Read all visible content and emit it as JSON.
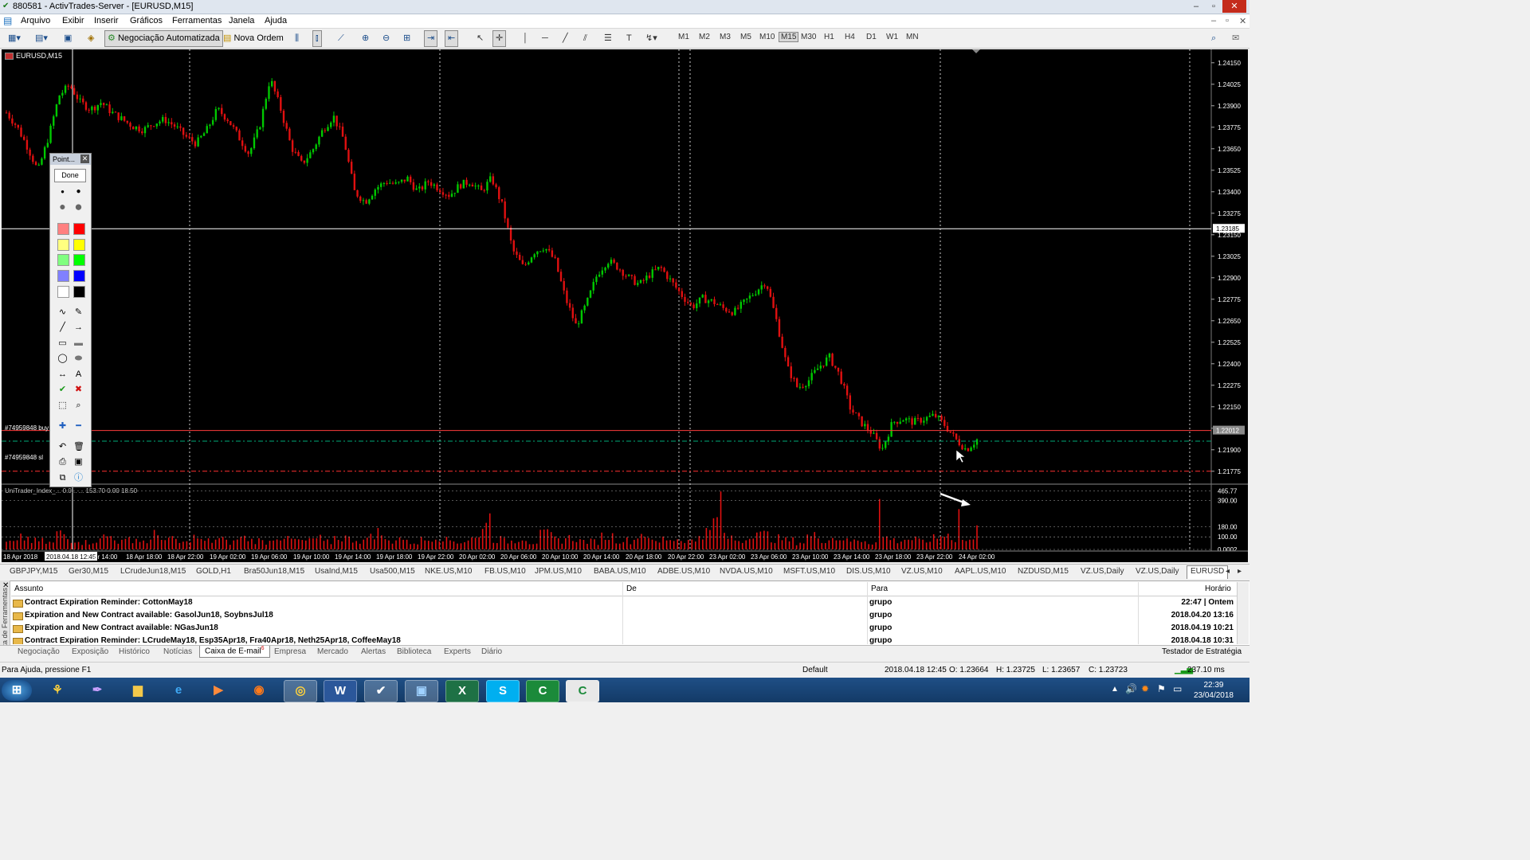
{
  "window": {
    "title": "880581 - ActivTrades-Server - [EURUSD,M15]"
  },
  "menu": [
    "Arquivo",
    "Exibir",
    "Inserir",
    "Gráficos",
    "Ferramentas",
    "Janela",
    "Ajuda"
  ],
  "toolbar": {
    "auto_trading": "Negociação Automatizada",
    "new_order": "Nova Ordem",
    "timeframes": [
      "M1",
      "M2",
      "M3",
      "M5",
      "M10",
      "M15",
      "M30",
      "H1",
      "H4",
      "D1",
      "W1",
      "MN"
    ],
    "selected_timeframe": "M15"
  },
  "chart": {
    "symbol_label": "EURUSD,M15",
    "indicator_label": "UniTrader_Index_... 0.0... ... 153.70 0.00 18.50",
    "trade_buy_label": "#74959848 buy",
    "trade_sl_label": "#74959848 sl",
    "current_price": "1.23185",
    "bid_price": "1.22012",
    "indicator_levels": [
      "465.77",
      "390.00",
      "180.00",
      "100.00",
      "0.0002"
    ],
    "colors": {
      "bg": "#000000",
      "bull": "#00c800",
      "bear": "#e01010",
      "grid": "#ffffff",
      "price_line": "#ffffff",
      "bid_line": "#ff3b3b",
      "tp_line": "#00aa77",
      "sl_line": "#ff3030",
      "volume": "#e01010"
    }
  },
  "chart_data": {
    "type": "candlestick",
    "symbol": "EURUSD",
    "timeframe": "M15",
    "y_ticks": [
      "1.24150",
      "1.24025",
      "1.23900",
      "1.23775",
      "1.23650",
      "1.23525",
      "1.23400",
      "1.23275",
      "1.23150",
      "1.23025",
      "1.22900",
      "1.22775",
      "1.22650",
      "1.22525",
      "1.22400",
      "1.22275",
      "1.22150",
      "1.22025",
      "1.21900",
      "1.21775"
    ],
    "ylim": [
      1.217,
      1.242
    ],
    "x_ticks": [
      "18 Apr 2018",
      "2018.04.18 12:45",
      "pr 14:00",
      "18 Apr 18:00",
      "18 Apr 22:00",
      "19 Apr 02:00",
      "19 Apr 06:00",
      "19 Apr 10:00",
      "19 Apr 14:00",
      "19 Apr 18:00",
      "19 Apr 22:00",
      "20 Apr 02:00",
      "20 Apr 06:00",
      "20 Apr 10:00",
      "20 Apr 14:00",
      "20 Apr 18:00",
      "20 Apr 22:00",
      "23 Apr 02:00",
      "23 Apr 06:00",
      "23 Apr 10:00",
      "23 Apr 14:00",
      "23 Apr 18:00",
      "23 Apr 22:00",
      "24 Apr 02:00"
    ],
    "close_path": [
      1.2386,
      1.2378,
      1.2366,
      1.2352,
      1.2372,
      1.2396,
      1.2402,
      1.2392,
      1.2388,
      1.2392,
      1.2386,
      1.2382,
      1.2378,
      1.2376,
      1.238,
      1.2382,
      1.2378,
      1.2372,
      1.2368,
      1.2376,
      1.2388,
      1.2382,
      1.2372,
      1.2362,
      1.2378,
      1.2406,
      1.2388,
      1.2366,
      1.2356,
      1.2364,
      1.2376,
      1.2384,
      1.237,
      1.234,
      1.2334,
      1.2342,
      1.2346,
      1.2344,
      1.2348,
      1.234,
      1.2346,
      1.2342,
      1.2338,
      1.2344,
      1.2346,
      1.234,
      1.2348,
      1.2332,
      1.2306,
      1.2296,
      1.2305,
      1.2308,
      1.23,
      1.2278,
      1.2262,
      1.2275,
      1.2292,
      1.23,
      1.2296,
      1.229,
      1.2286,
      1.2292,
      1.2296,
      1.2288,
      1.228,
      1.2273,
      1.2278,
      1.2276,
      1.2272,
      1.227,
      1.2276,
      1.2282,
      1.2288,
      1.2265,
      1.2238,
      1.2226,
      1.223,
      1.2238,
      1.2244,
      1.2233,
      1.2214,
      1.2206,
      1.22,
      1.219,
      1.2206,
      1.2208,
      1.2206,
      1.2208,
      1.221,
      1.2204,
      1.2196,
      1.219,
      1.2196
    ],
    "price_lines": {
      "current": 1.23185,
      "bid": 1.22012,
      "take_profit": 1.2195,
      "stop_loss": 1.21775
    },
    "volume": [
      60,
      95,
      70,
      55,
      130,
      85,
      60,
      75,
      110,
      65,
      90,
      70,
      120,
      80,
      55,
      100,
      70,
      85,
      60,
      95,
      75,
      65,
      110,
      80,
      70,
      90,
      60,
      100,
      85,
      75,
      140,
      70,
      95,
      60,
      80,
      110,
      75,
      65,
      90,
      255,
      85,
      70,
      100,
      60,
      120,
      80,
      95,
      70,
      65,
      110,
      80,
      75,
      130,
      60,
      90,
      85,
      70,
      140,
      235,
      100,
      80,
      150,
      120,
      90,
      75,
      60,
      110,
      85,
      95,
      70,
      80,
      60,
      100,
      75,
      85,
      65,
      90,
      120,
      70,
      80,
      160
    ]
  },
  "symbol_tabs": [
    "GBPJPY,M15",
    "Ger30,M15",
    "LCrudeJun18,M15",
    "GOLD,H1",
    "Bra50Jun18,M15",
    "UsaInd,M15",
    "Usa500,M15",
    "NKE.US,M10",
    "FB.US,M10",
    "JPM.US,M10",
    "BABA.US,M10",
    "ADBE.US,M10",
    "NVDA.US,M10",
    "MSFT.US,M10",
    "DIS.US,M10",
    "VZ.US,M10",
    "AAPL.US,M10",
    "NZDUSD,M15",
    "VZ.US,Daily",
    "VZ.US,Daily",
    "EURUSD"
  ],
  "terminal": {
    "side_label": "Caixa de Ferramentas",
    "headers": {
      "subject": "Assunto",
      "from": "De",
      "to": "Para",
      "time": "Horário"
    },
    "rows": [
      {
        "subject": "Contract Expiration Reminder: CottonMay18",
        "from": "",
        "to": "grupo",
        "time": "22:47 | Ontem"
      },
      {
        "subject": "Expiration and New Contract available: GasolJun18, SoybnsJul18",
        "from": "",
        "to": "grupo",
        "time": "2018.04.20 13:16"
      },
      {
        "subject": "Expiration and New Contract available: NGasJun18",
        "from": "",
        "to": "grupo",
        "time": "2018.04.19 10:21"
      },
      {
        "subject": "Contract Expiration Reminder: LCrudeMay18, Esp35Apr18, Fra40Apr18, Neth25Apr18, CoffeeMay18",
        "from": "",
        "to": "grupo",
        "time": "2018.04.18 10:31"
      }
    ],
    "tabs": [
      "Negociação",
      "Exposição",
      "Histórico",
      "Notícias",
      "Caixa de E-mail",
      "Empresa",
      "Mercado",
      "Alertas",
      "Biblioteca",
      "Experts",
      "Diário"
    ],
    "active_tab": "Caixa de E-mail",
    "mail_badge": "6",
    "right_tab": "Testador de Estratégia"
  },
  "status": {
    "help": "Para Ajuda, pressione F1",
    "profile": "Default",
    "datetime": "2018.04.18 12:45",
    "open": "O: 1.23664",
    "high": "H: 1.23725",
    "low": "L: 1.23657",
    "close": "C: 1.23723",
    "ping": "237.10 ms"
  },
  "point_panel": {
    "title": "Point...",
    "done": "Done",
    "colors": [
      "#ff8080",
      "#ff0000",
      "#ffff80",
      "#ffff00",
      "#80ff80",
      "#00ff00",
      "#8080ff",
      "#0000ff",
      "#ffffff",
      "#000000"
    ]
  },
  "taskbar": {
    "time": "22:39",
    "date": "23/04/2018",
    "apps": [
      "orb",
      "mt4",
      "feather",
      "folder",
      "ie",
      "media",
      "firefox",
      "chrome",
      "word",
      "check",
      "desk",
      "excel",
      "skype",
      "ctrader1",
      "ctrader2"
    ]
  }
}
